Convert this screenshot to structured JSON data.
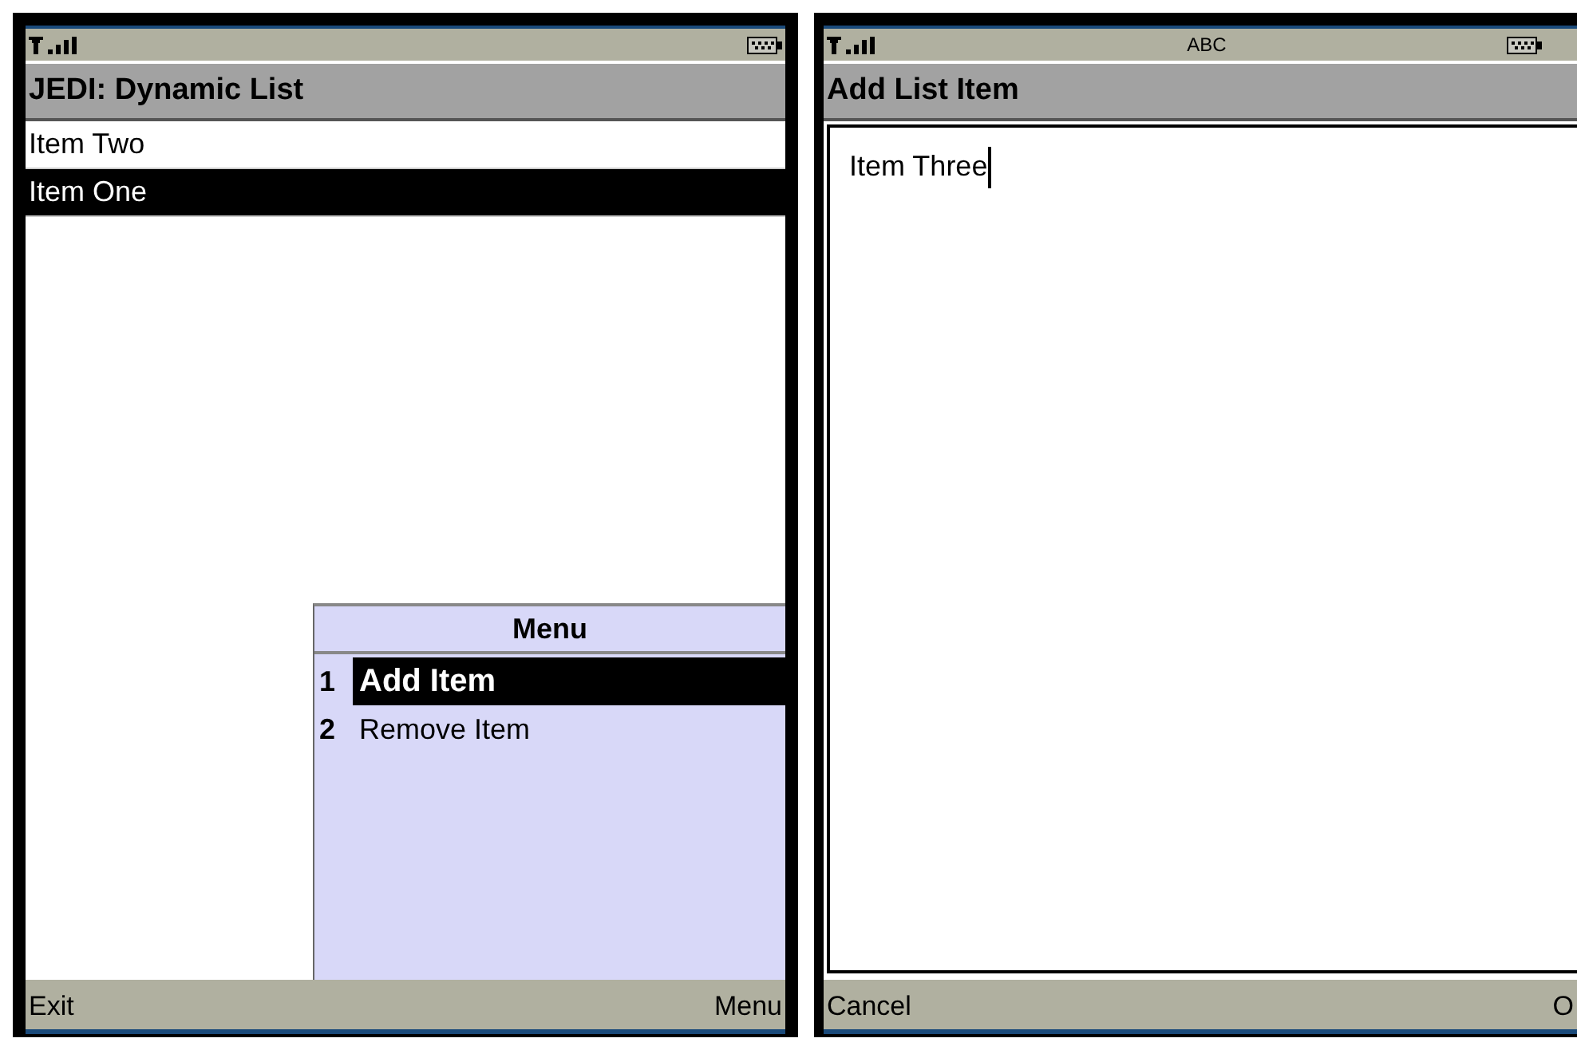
{
  "screens": [
    {
      "kind": "list",
      "title": "JEDI: Dynamic List",
      "list": [
        {
          "label": "Item Two",
          "selected": false
        },
        {
          "label": "Item One",
          "selected": true
        }
      ],
      "menu": {
        "title": "Menu",
        "items": [
          {
            "number": "1",
            "label": "Add Item",
            "selected": true
          },
          {
            "number": "2",
            "label": "Remove Item",
            "selected": false
          }
        ]
      },
      "softkeys": [
        "Exit",
        "Menu"
      ]
    },
    {
      "kind": "form",
      "input_mode": "ABC",
      "title": "Add List Item",
      "field": {
        "value": "Item Three",
        "focused": true
      },
      "softkeys": [
        "Cancel",
        "O"
      ]
    }
  ]
}
